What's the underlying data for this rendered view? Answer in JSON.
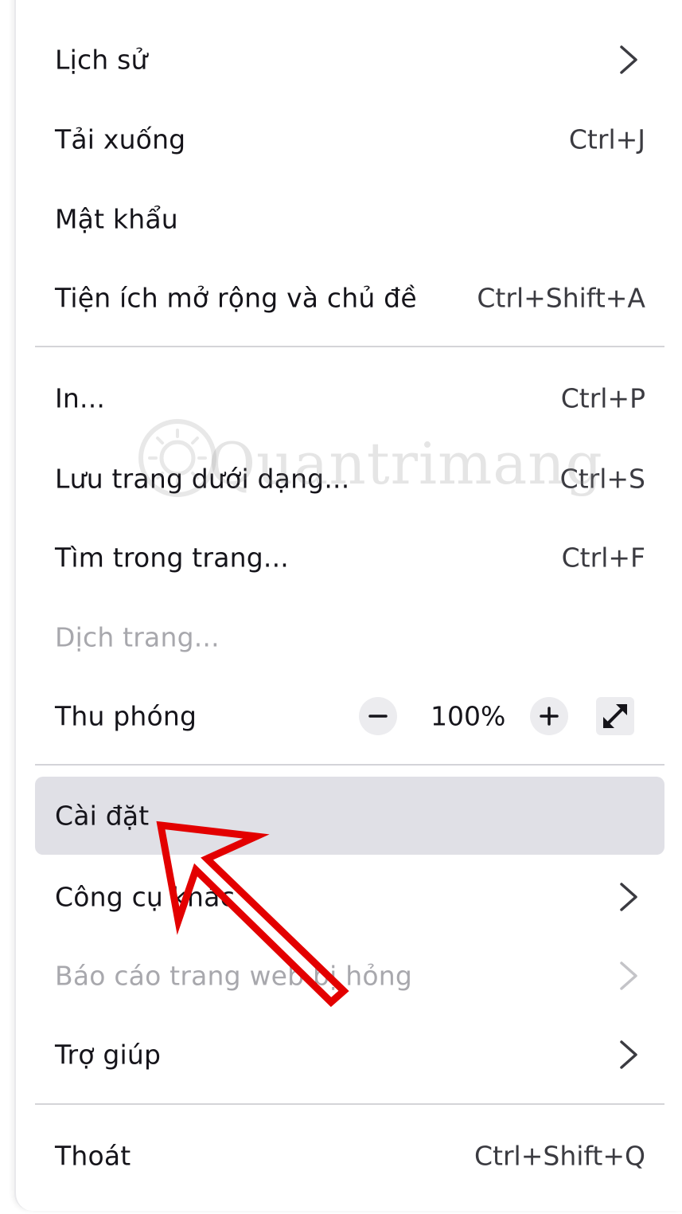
{
  "menu": {
    "items": [
      {
        "label": "Lịch sử",
        "shortcut": "",
        "submenu": true
      },
      {
        "label": "Tải xuống",
        "shortcut": "Ctrl+J"
      },
      {
        "label": "Mật khẩu",
        "shortcut": ""
      },
      {
        "label": "Tiện ích mở rộng và chủ đề",
        "shortcut": "Ctrl+Shift+A"
      },
      {
        "label": "In...",
        "shortcut": "Ctrl+P"
      },
      {
        "label": "Lưu trang dưới dạng...",
        "shortcut": "Ctrl+S"
      },
      {
        "label": "Tìm trong trang...",
        "shortcut": "Ctrl+F"
      },
      {
        "label": "Dịch trang...",
        "disabled": true
      },
      {
        "label": "Thu phóng"
      },
      {
        "label": "Cài đặt",
        "highlighted": true
      },
      {
        "label": "Công cụ khác",
        "submenu": true
      },
      {
        "label": "Báo cáo trang web bị hỏng",
        "submenu": true,
        "disabled": true
      },
      {
        "label": "Trợ giúp",
        "submenu": true
      },
      {
        "label": "Thoát",
        "shortcut": "Ctrl+Shift+Q"
      }
    ],
    "zoom": {
      "value": "100%",
      "decrease_icon": "minus-icon",
      "increase_icon": "plus-icon",
      "fullscreen_icon": "expand-arrows-icon"
    }
  },
  "watermark": {
    "text": "Quantrimang"
  },
  "colors": {
    "highlight": "#e0e0e6",
    "text": "#15141a",
    "disabled_text": "#a8a8ad",
    "arrow": "#e30000"
  }
}
